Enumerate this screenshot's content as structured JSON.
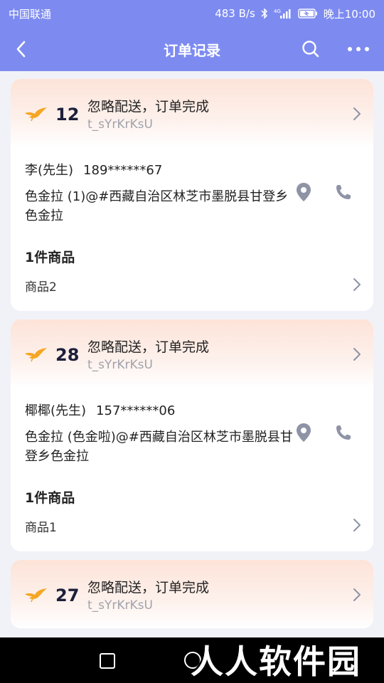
{
  "status_bar": {
    "carrier": "中国联通",
    "speed": "483 B/s",
    "network": "4G",
    "time": "晚上10:00"
  },
  "header": {
    "title": "订单记录"
  },
  "orders": [
    {
      "number": "12",
      "status": "忽略配送，订单完成",
      "code": "t_sYrKrKsU",
      "customer": "李(先生)",
      "phone": "189******67",
      "address": "色金拉 (1)@#西藏自治区林芝市墨脱县甘登乡色金拉",
      "item_count": "1件商品",
      "item_name": "商品2"
    },
    {
      "number": "28",
      "status": "忽略配送，订单完成",
      "code": "t_sYrKrKsU",
      "customer": "椰椰(先生)",
      "phone": "157******06",
      "address": "色金拉 (色金啦)@#西藏自治区林芝市墨脱县甘登乡色金拉",
      "item_count": "1件商品",
      "item_name": "商品1"
    },
    {
      "number": "27",
      "status": "忽略配送，订单完成",
      "code": "t_sYrKrKsU"
    }
  ],
  "watermark": "人人软件园",
  "colors": {
    "header_bg": "#7d8bf1",
    "bird": "#f5a623",
    "icon_gray": "#8e93a6"
  },
  "icons": {
    "back": "chevron-left-icon",
    "search": "search-icon",
    "more": "more-dots-icon",
    "bird": "bird-icon",
    "location": "location-pin-icon",
    "call": "phone-icon"
  }
}
